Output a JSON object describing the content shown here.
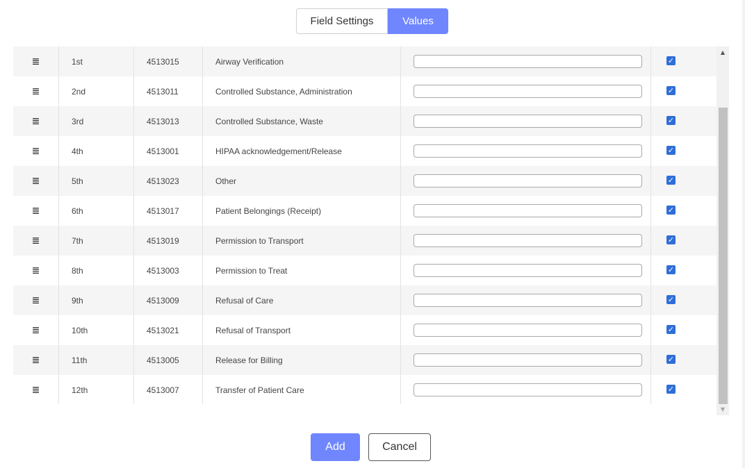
{
  "tabs": [
    {
      "label": "Field Settings",
      "active": false
    },
    {
      "label": "Values",
      "active": true
    }
  ],
  "rows": [
    {
      "order": "1st",
      "code": "4513015",
      "description": "Airway Verification",
      "value": "",
      "checked": true
    },
    {
      "order": "2nd",
      "code": "4513011",
      "description": "Controlled Substance, Administration",
      "value": "",
      "checked": true
    },
    {
      "order": "3rd",
      "code": "4513013",
      "description": "Controlled Substance, Waste",
      "value": "",
      "checked": true
    },
    {
      "order": "4th",
      "code": "4513001",
      "description": "HIPAA acknowledgement/Release",
      "value": "",
      "checked": true
    },
    {
      "order": "5th",
      "code": "4513023",
      "description": "Other",
      "value": "",
      "checked": true
    },
    {
      "order": "6th",
      "code": "4513017",
      "description": "Patient Belongings (Receipt)",
      "value": "",
      "checked": true
    },
    {
      "order": "7th",
      "code": "4513019",
      "description": "Permission to Transport",
      "value": "",
      "checked": true
    },
    {
      "order": "8th",
      "code": "4513003",
      "description": "Permission to Treat",
      "value": "",
      "checked": true
    },
    {
      "order": "9th",
      "code": "4513009",
      "description": "Refusal of Care",
      "value": "",
      "checked": true
    },
    {
      "order": "10th",
      "code": "4513021",
      "description": "Refusal of Transport",
      "value": "",
      "checked": true
    },
    {
      "order": "11th",
      "code": "4513005",
      "description": "Release for Billing",
      "value": "",
      "checked": true
    },
    {
      "order": "12th",
      "code": "4513007",
      "description": "Transfer of Patient Care",
      "value": "",
      "checked": true
    }
  ],
  "icons": {
    "drag": "drag-handle-icon",
    "check": "checkmark-icon",
    "scroll_up": "scroll-up-arrow-icon",
    "scroll_down": "scroll-down-arrow-icon"
  },
  "footer": {
    "add_label": "Add",
    "cancel_label": "Cancel"
  },
  "colors": {
    "accent": "#6f86ff",
    "checkbox": "#2f6ed8",
    "row_alt": "#f5f5f5"
  }
}
